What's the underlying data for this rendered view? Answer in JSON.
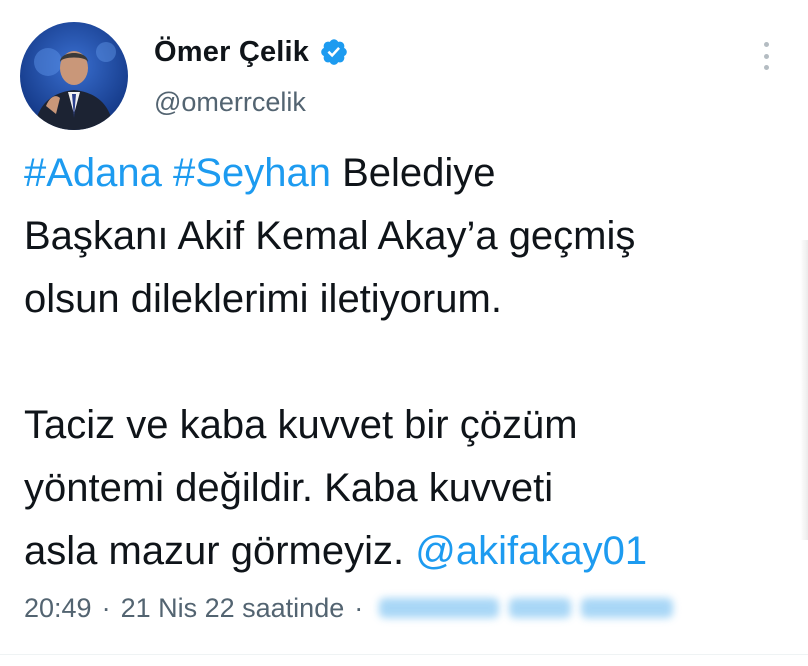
{
  "author": {
    "display_name": "Ömer Çelik",
    "handle": "@omerrcelik",
    "verified_icon": "verified-badge-icon",
    "avatar": "profile-photo"
  },
  "tweet": {
    "lines": [
      {
        "segments": [
          {
            "text": "#Adana",
            "type": "hashtag"
          },
          {
            "text": " ",
            "type": "text"
          },
          {
            "text": "#Seyhan",
            "type": "hashtag"
          },
          {
            "text": " Belediye",
            "type": "text"
          }
        ]
      },
      {
        "segments": [
          {
            "text": "Başkanı Akif Kemal Akay’a geçmiş",
            "type": "text"
          }
        ]
      },
      {
        "segments": [
          {
            "text": "olsun dileklerimi iletiyorum.",
            "type": "text"
          }
        ]
      },
      {
        "segments": [
          {
            "text": "Taciz ve kaba kuvvet bir çözüm",
            "type": "text"
          }
        ]
      },
      {
        "segments": [
          {
            "text": "yöntemi değildir. Kaba kuvveti",
            "type": "text"
          }
        ]
      },
      {
        "segments": [
          {
            "text": "asla mazur görmeyiz. ",
            "type": "text"
          },
          {
            "text": "@akifakay01",
            "type": "mention"
          }
        ]
      }
    ]
  },
  "meta": {
    "time": "20:49",
    "separator": "·",
    "date": "21 Nis 22 saatinde",
    "separator2": "·"
  },
  "colors": {
    "link": "#1d9bf0",
    "text": "#0f1419",
    "secondary": "#536471"
  }
}
